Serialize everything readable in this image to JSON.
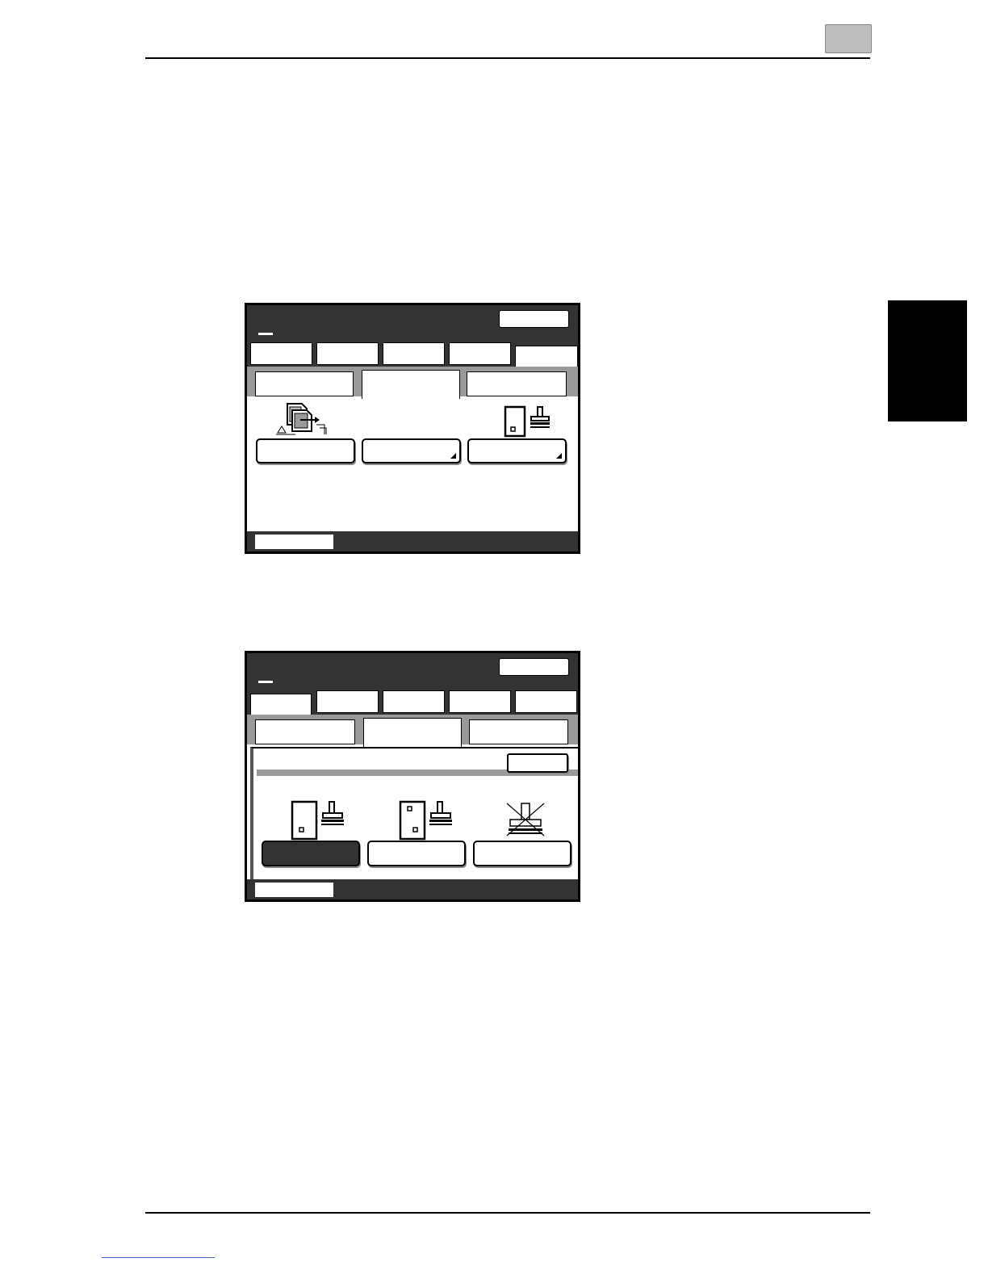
{
  "page": {
    "chapter_number": "",
    "side_tab": ""
  },
  "screen1": {
    "header_dash": "—",
    "main_tabs": [
      "",
      "",
      "",
      "",
      ""
    ],
    "active_main_tab": 4,
    "sub_tabs": [
      "",
      "",
      ""
    ],
    "active_sub_tab": 1,
    "buttons": [
      {
        "label": "",
        "icon": "page-shift-icon",
        "has_more": false
      },
      {
        "label": "",
        "icon": "",
        "has_more": true
      },
      {
        "label": "",
        "icon": "stamp-page-icon",
        "has_more": true
      }
    ]
  },
  "screen2": {
    "header_dash": "—",
    "main_tabs": [
      "",
      "",
      "",
      "",
      ""
    ],
    "active_main_tab": 0,
    "sub_tabs": [
      "",
      "",
      ""
    ],
    "active_sub_tab": 1,
    "options": [
      {
        "label": "",
        "icon": "stamp-one-corner-icon",
        "selected": true
      },
      {
        "label": "",
        "icon": "stamp-two-corners-icon",
        "selected": false
      },
      {
        "label": "",
        "icon": "no-stamp-icon",
        "selected": false
      }
    ]
  },
  "colors": {
    "header_dark": "#333333",
    "tab_band_gray": "#999999",
    "selected_dark": "#333333"
  }
}
